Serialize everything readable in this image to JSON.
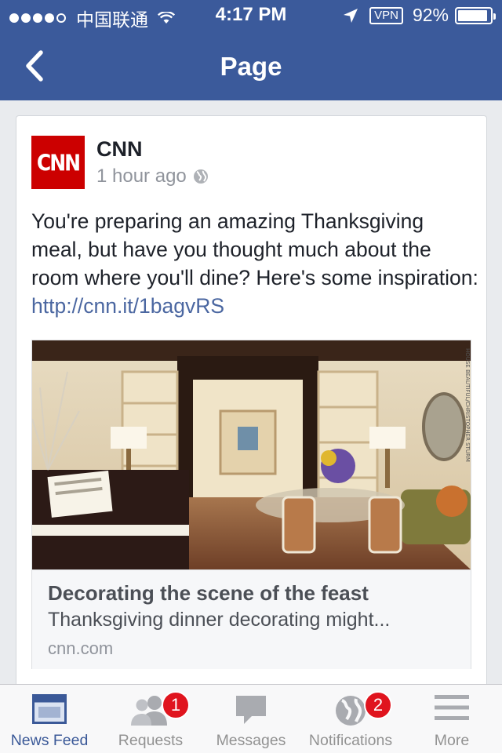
{
  "status_bar": {
    "carrier": "中国联通",
    "time": "4:17 PM",
    "vpn": "VPN",
    "battery_percent": "92%",
    "battery_level": 0.92,
    "signal_bars_filled": 4
  },
  "nav": {
    "title": "Page",
    "back_icon": "chevron-left-icon"
  },
  "post": {
    "page_name": "CNN",
    "logo_text": "CNN",
    "time_ago": "1 hour ago",
    "privacy_icon": "globe-icon",
    "text": "You're preparing an amazing Thanksgiving meal, but have you thought much about the room where you'll dine? Here's some inspiration: ",
    "link": "http://cnn.it/1bagvRS",
    "preview": {
      "image_credit": "HOUSE BEAUTIFUL/CHRISTOPHER STURM",
      "title": "Decorating the scene of the feast",
      "description": "Thanksgiving dinner decorating might...",
      "domain": "cnn.com"
    }
  },
  "tabs": [
    {
      "label": "News Feed",
      "icon": "news-feed-icon",
      "active": true,
      "badge": ""
    },
    {
      "label": "Requests",
      "icon": "friend-requests-icon",
      "active": false,
      "badge": "1"
    },
    {
      "label": "Messages",
      "icon": "messages-icon",
      "active": false,
      "badge": ""
    },
    {
      "label": "Notifications",
      "icon": "notifications-globe-icon",
      "active": false,
      "badge": "2"
    },
    {
      "label": "More",
      "icon": "hamburger-menu-icon",
      "active": false,
      "badge": ""
    }
  ],
  "colors": {
    "brand_blue": "#3b5a9b",
    "link_blue": "#4b67a1",
    "cnn_red": "#cc0000",
    "badge_red": "#e0141e"
  }
}
